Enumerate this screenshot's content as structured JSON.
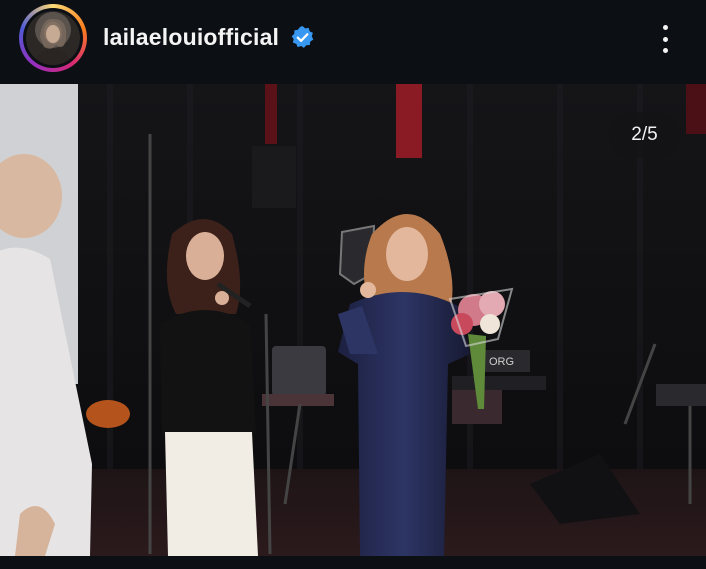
{
  "post": {
    "username": "lailaelouiofficial",
    "verified": true,
    "more_icon": "more-vertical-icon",
    "media": {
      "carousel_position": "2/5",
      "current_index": 2,
      "total": 5
    }
  },
  "colors": {
    "background": "#0c0f14",
    "verified_badge": "#3897f0",
    "story_ring": [
      "#feda75",
      "#fa7e1e",
      "#d62976",
      "#962fbf",
      "#4f5bd5"
    ]
  }
}
